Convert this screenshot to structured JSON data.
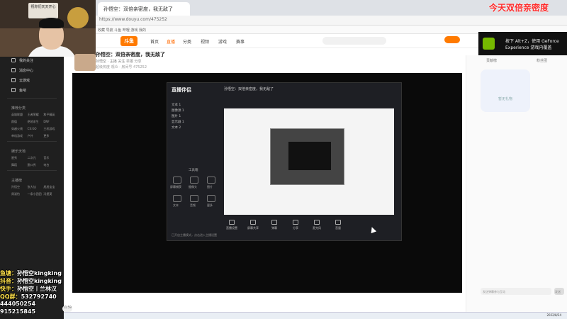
{
  "browser": {
    "tab_title": "孙悟空：双倍亲密度，我无敌了",
    "address": "https://www.douyu.com/475252",
    "bookmarks": "收藏  导航  斗鱼  哔哩  游戏  我的"
  },
  "site": {
    "logo": "斗鱼",
    "nav": [
      "首页",
      "直播",
      "分类",
      "视频",
      "游戏",
      "赛事"
    ],
    "nav_active_index": 1
  },
  "stream": {
    "title": "孙悟空：双倍亲密度，我无敌了",
    "subline": "孙悟空 · 主播  关注  举报  分享",
    "meta": "超级热度  观众  ·  房间号 475252"
  },
  "obs": {
    "brand": "直播伴侣",
    "title_text": "孙悟空：双倍亲密度，我无敌了",
    "sources": [
      "文本 1",
      "图像源 1",
      "图片 1",
      "显示器 1",
      "文本 2"
    ],
    "tools_label": "工具箱",
    "tools": [
      "屏幕捕获",
      "摄像头",
      "图片",
      "文本",
      "音频",
      "更多"
    ],
    "bottom": [
      "直播设置",
      "屏幕共享",
      "弹幕",
      "分享",
      "麦克风",
      "音量"
    ],
    "footer": "已开启主播模式，点击进入主播设置"
  },
  "right": {
    "tabs": [
      "贡献榜",
      "粉丝团"
    ],
    "mascot": "暂无礼物",
    "input_placeholder": "发送弹幕参与互动",
    "send": "发送"
  },
  "sidebar": {
    "items": [
      "我的关注",
      "消息中心",
      "云游戏",
      "鱼吧"
    ],
    "section1": "推荐分类",
    "grid1": [
      "英雄联盟",
      "王者荣耀",
      "和平精英",
      "颜值",
      "绝地求生",
      "DNF",
      "穿越火线",
      "CS:GO",
      "主机游戏",
      "单机游戏",
      "户外",
      "更多"
    ],
    "section2": "娱乐天地",
    "grid2": [
      "星秀",
      "二次元",
      "音乐",
      "舞蹈",
      "脱口秀",
      "电台"
    ],
    "section3": "主播榜",
    "grid3": [
      "孙悟空",
      "张大仙",
      "旭旭宝宝",
      "周淑怡",
      "一条小团团",
      "冯提莫"
    ]
  },
  "webcam": {
    "sign": "祝你们天天开心"
  },
  "overlay": {
    "banner": "今天双倍亲密度",
    "nvidia_text": "按下 Alt+Z，使用 GeForce Experience 游戏内覆盖",
    "social": [
      {
        "k": "鱼塘：",
        "v": "孙悟空kingking"
      },
      {
        "k": "抖音：",
        "v": "孙悟空kingking"
      },
      {
        "k": "快手：",
        "v": "孙悟空丨兰林汉"
      },
      {
        "k": "QQ群：",
        "v": "532792740"
      },
      {
        "k": "",
        "v": "444050254"
      },
      {
        "k": "",
        "v": "915215845"
      }
    ]
  },
  "taskbar": {
    "clock": "2022/8/24",
    "badge": "11:59"
  }
}
